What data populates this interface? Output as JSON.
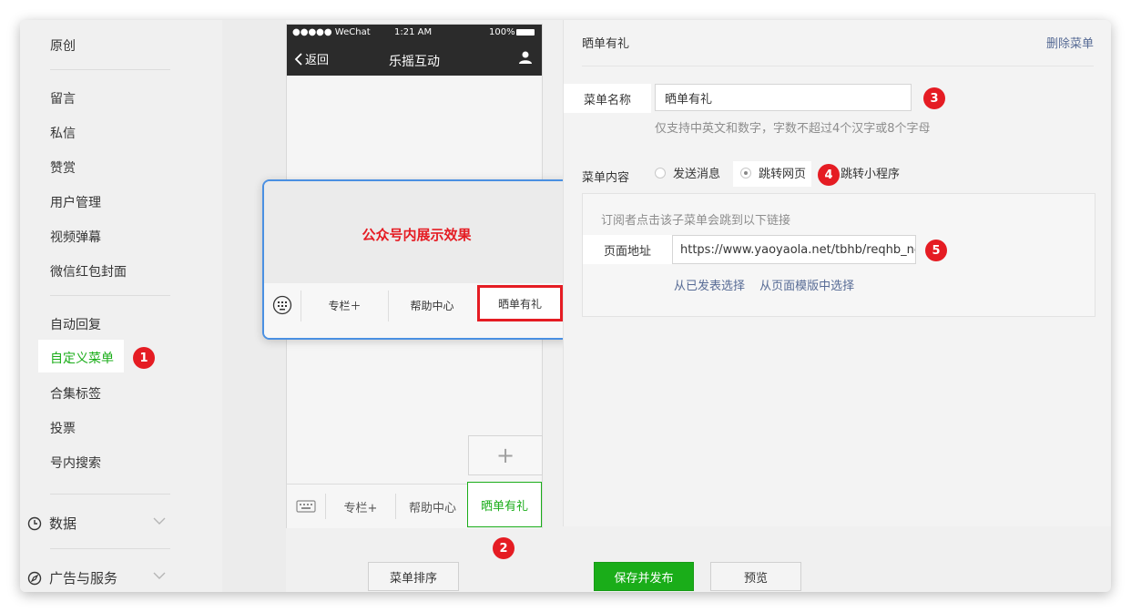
{
  "sidebar": {
    "top_item": "原创",
    "group1": [
      "留言",
      "私信",
      "赞赏",
      "用户管理",
      "视频弹幕",
      "微信红包封面"
    ],
    "group2": [
      "自动回复",
      "自定义菜单",
      "合集标签",
      "投票",
      "号内搜索"
    ],
    "active_item": "自定义菜单",
    "sections": [
      {
        "label": "数据",
        "icon": "clock-icon"
      },
      {
        "label": "广告与服务",
        "icon": "compass-icon"
      }
    ]
  },
  "phone": {
    "carrier": "●●●●● WeChat",
    "time": "1:21 AM",
    "battery": "100%",
    "back_label": "返回",
    "title": "乐摇互动",
    "bottom_menu": [
      "专栏+",
      "帮助中心",
      "晒单有礼"
    ],
    "add_label": "+"
  },
  "preview": {
    "title": "公众号内展示效果",
    "menu": [
      "专栏＋",
      "帮助中心",
      "晒单有礼"
    ]
  },
  "editor": {
    "title": "晒单有礼",
    "delete_label": "删除菜单",
    "name_label": "菜单名称",
    "name_value": "晒单有礼",
    "name_hint": "仅支持中英文和数字，字数不超过4个汉字或8个字母",
    "content_label": "菜单内容",
    "options": [
      "发送消息",
      "跳转网页",
      "跳转小程序"
    ],
    "selected_option": "跳转网页",
    "url_desc": "订阅者点击该子菜单会跳到以下链接",
    "url_label": "页面地址",
    "url_value": "https://www.yaoyaola.net/tbhb/reqhb_ne",
    "url_links": [
      "从已发表选择",
      "从页面模版中选择"
    ]
  },
  "badges": [
    "1",
    "2",
    "3",
    "4",
    "5"
  ],
  "footer": {
    "sort_label": "菜单排序",
    "save_label": "保存并发布",
    "preview_label": "预览"
  },
  "colors": {
    "accent_green": "#1aad19",
    "annotation_red": "#e51c23",
    "link_blue": "#576b95",
    "popup_border": "#4a90e2"
  }
}
